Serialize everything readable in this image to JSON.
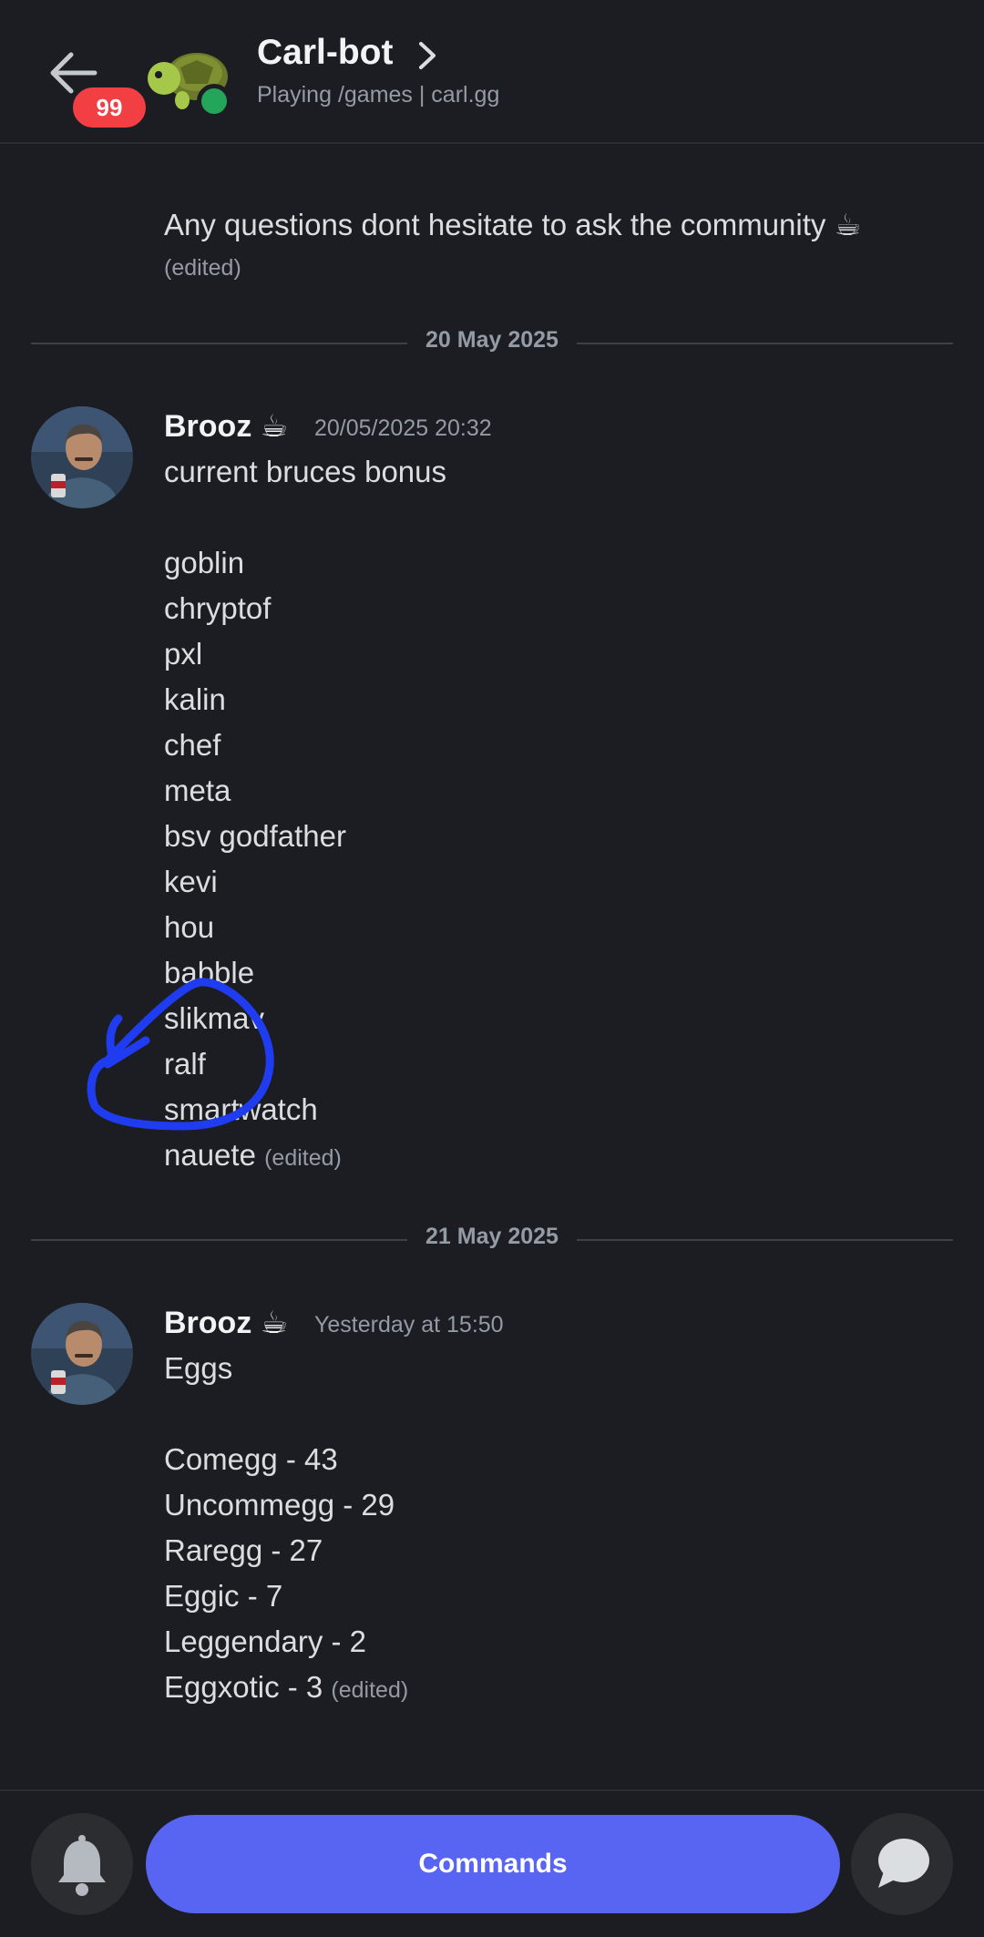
{
  "header": {
    "unread_count": "99",
    "bot_name": "Carl-bot",
    "bot_status": "Playing /games | carl.gg",
    "status_color": "#23a55a"
  },
  "prev_message": {
    "text": "Any questions dont hesitate to ask the community ☕",
    "edited": "(edited)"
  },
  "day1": {
    "label": "20 May 2025"
  },
  "message1": {
    "author": "Brooz ☕",
    "timestamp": "20/05/2025 20:32",
    "title": "current bruces bonus",
    "items": [
      "goblin",
      "chryptof",
      "pxl",
      "kalin",
      "chef",
      "meta",
      "bsv godfather",
      "kevi",
      "hou",
      "babble",
      "slikmav",
      "ralf",
      "smartwatch",
      "nauete"
    ],
    "edited": "(edited)"
  },
  "day2": {
    "label": "21 May 2025"
  },
  "message2": {
    "author": "Brooz ☕",
    "timestamp": "Yesterday at 15:50",
    "title": "Eggs",
    "items": [
      "Comegg - 43",
      "Uncommegg - 29",
      "Raregg - 27",
      "Eggic - 7",
      "Leggendary - 2",
      "Eggxotic - 3"
    ],
    "edited": "(edited)"
  },
  "bottom": {
    "commands_label": "Commands",
    "accent": "#5865f2"
  },
  "icons": [
    "back-arrow-icon",
    "bell-icon",
    "chat-bubble-icon",
    "chevron-right-icon",
    "turtle-avatar-icon"
  ]
}
